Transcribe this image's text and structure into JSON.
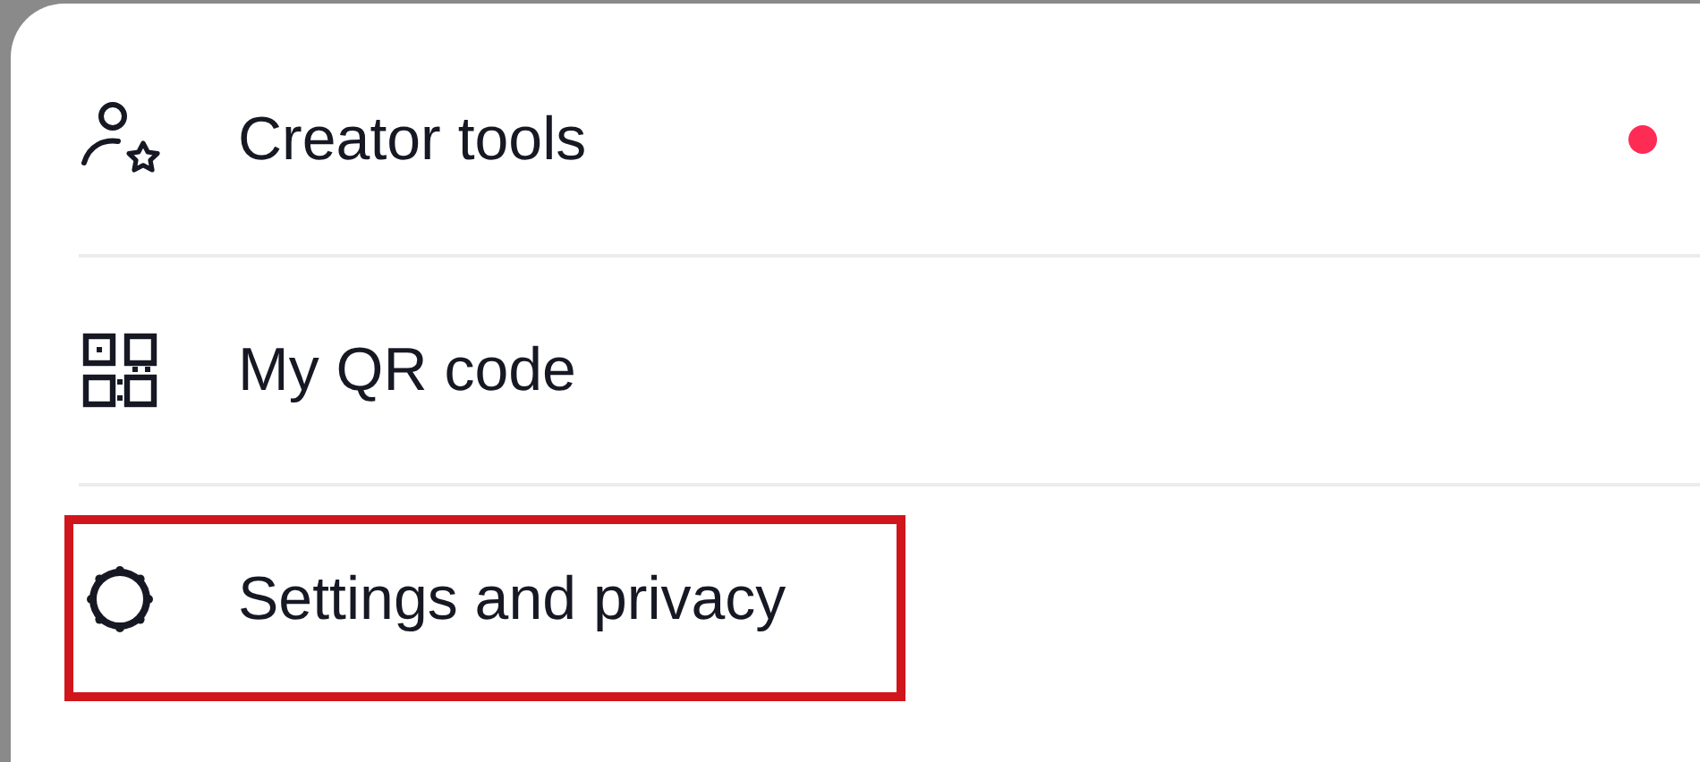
{
  "menu": {
    "items": [
      {
        "kind": "creator",
        "label": "Creator tools",
        "notification_dot": true,
        "highlighted": false
      },
      {
        "kind": "qr",
        "label": "My QR code",
        "notification_dot": false,
        "highlighted": false
      },
      {
        "kind": "settings",
        "label": "Settings and privacy",
        "notification_dot": false,
        "highlighted": true
      }
    ]
  }
}
